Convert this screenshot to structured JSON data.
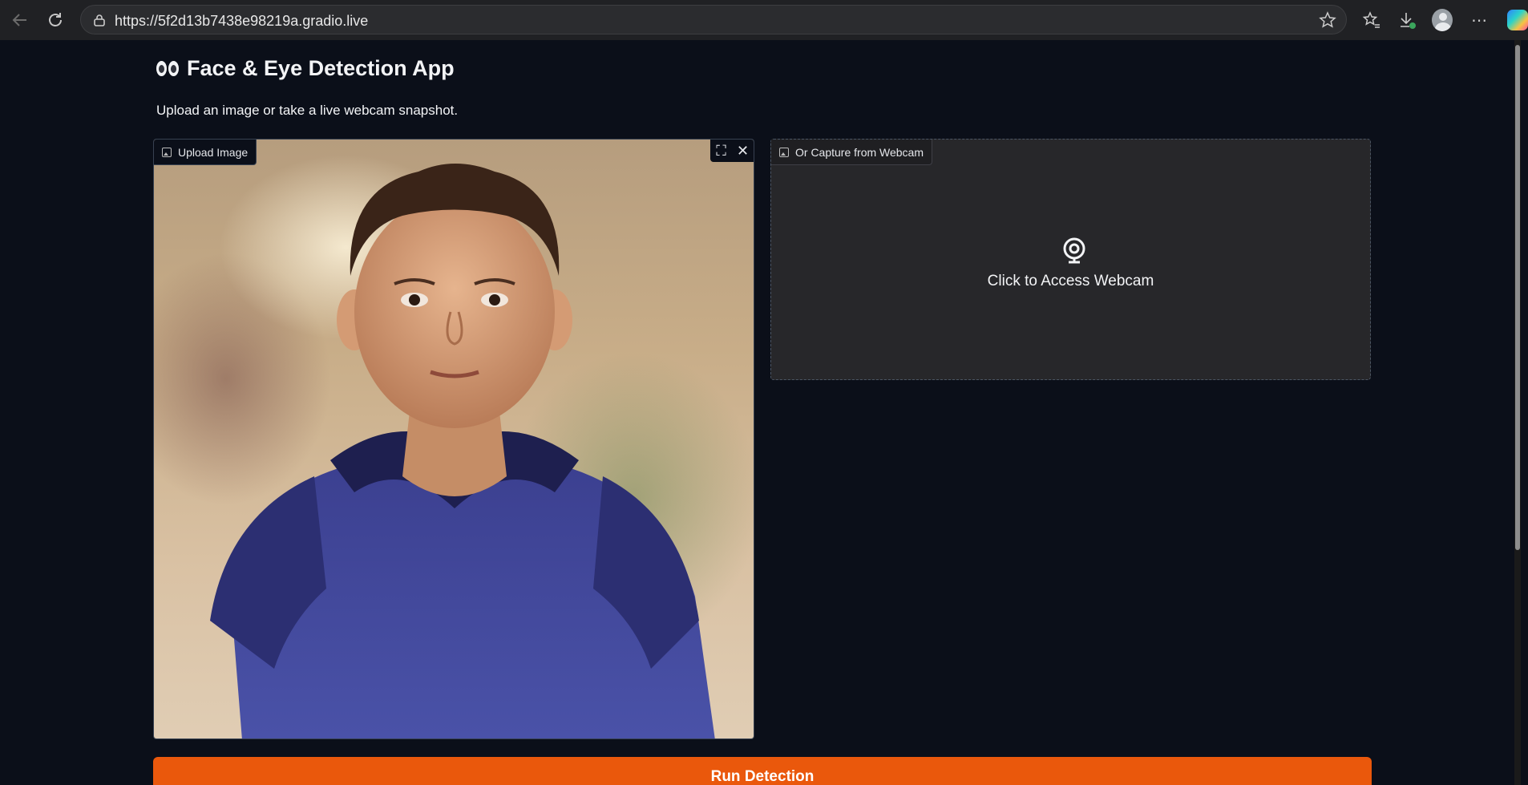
{
  "browser": {
    "url": "https://5f2d13b7438e98219a.gradio.live"
  },
  "app": {
    "title_icon": "eyes-emoji",
    "title": "Face & Eye Detection App",
    "subtitle": "Upload an image or take a live webcam snapshot."
  },
  "upload": {
    "label": "Upload Image",
    "fullscreen_icon": "fullscreen-icon",
    "close_icon": "close-icon"
  },
  "webcam": {
    "label": "Or Capture from Webcam",
    "prompt": "Click to Access Webcam",
    "icon": "webcam-icon"
  },
  "actions": {
    "run_label": "Run Detection"
  },
  "colors": {
    "accent": "#ea580c",
    "background": "#0b0f19"
  }
}
